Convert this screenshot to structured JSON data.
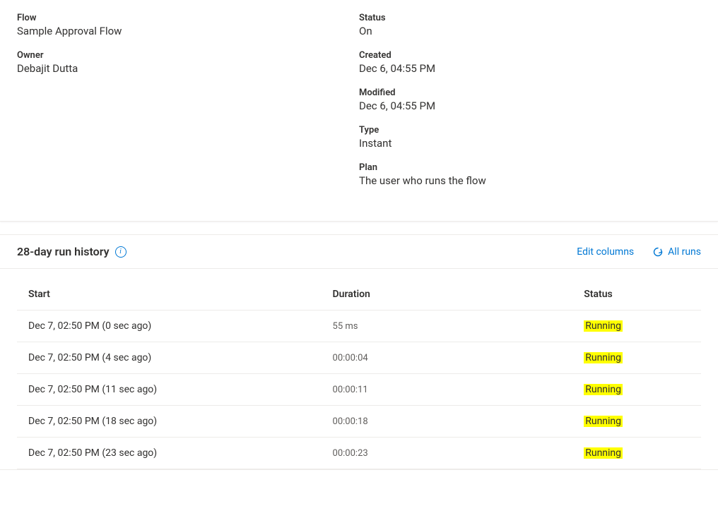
{
  "details": {
    "left": [
      {
        "label": "Flow",
        "value": "Sample Approval Flow"
      },
      {
        "label": "Owner",
        "value": "Debajit Dutta"
      }
    ],
    "right": [
      {
        "label": "Status",
        "value": "On"
      },
      {
        "label": "Created",
        "value": "Dec 6, 04:55 PM"
      },
      {
        "label": "Modified",
        "value": "Dec 6, 04:55 PM"
      },
      {
        "label": "Type",
        "value": "Instant"
      },
      {
        "label": "Plan",
        "value": "The user who runs the flow"
      }
    ]
  },
  "run_history": {
    "title": "28-day run history",
    "info_glyph": "i",
    "edit_columns": "Edit columns",
    "all_runs": "All runs",
    "columns": {
      "start": "Start",
      "duration": "Duration",
      "status": "Status"
    },
    "rows": [
      {
        "start": "Dec 7, 02:50 PM (0 sec ago)",
        "duration": "55 ms",
        "status": "Running"
      },
      {
        "start": "Dec 7, 02:50 PM (4 sec ago)",
        "duration": "00:00:04",
        "status": "Running"
      },
      {
        "start": "Dec 7, 02:50 PM (11 sec ago)",
        "duration": "00:00:11",
        "status": "Running"
      },
      {
        "start": "Dec 7, 02:50 PM (18 sec ago)",
        "duration": "00:00:18",
        "status": "Running"
      },
      {
        "start": "Dec 7, 02:50 PM (23 sec ago)",
        "duration": "00:00:23",
        "status": "Running"
      }
    ]
  }
}
